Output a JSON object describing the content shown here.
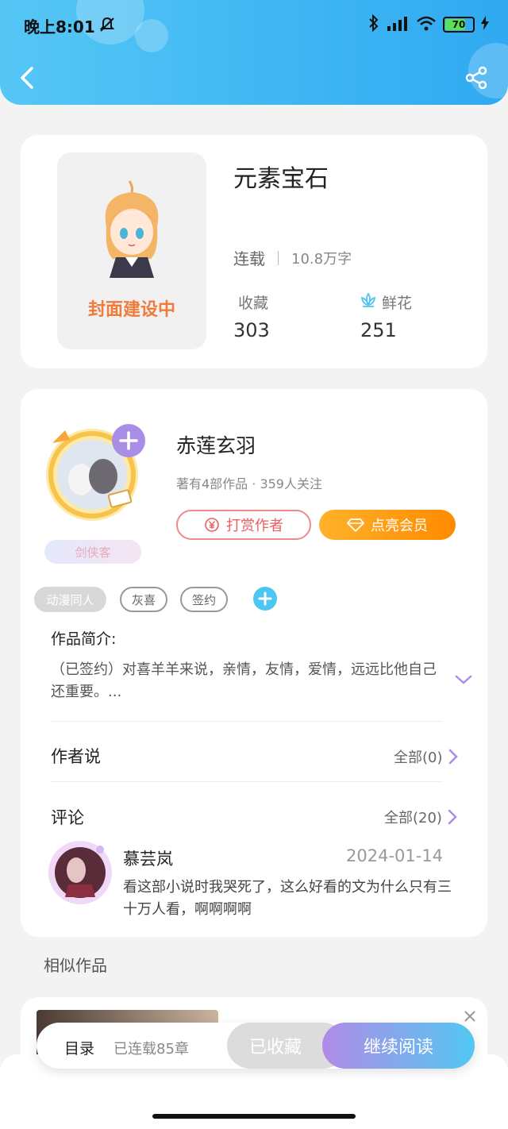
{
  "status_bar": {
    "time": "晚上8:01",
    "battery": "70",
    "battery_level": 0.7
  },
  "header": {
    "back_icon": "chevron-left-icon",
    "share_icon": "share-icon"
  },
  "book": {
    "title": "元素宝石",
    "cover_text": "封面建设中",
    "status": "连载",
    "word_count": "10.8万字",
    "favorites_label": "收藏",
    "favorites_value": "303",
    "flowers_label": "鲜花",
    "flowers_value": "251"
  },
  "author": {
    "name": "赤莲玄羽",
    "stats": "著有4部作品 · 359人关注",
    "badge": "剑侠客",
    "reward_button": "打赏作者",
    "vip_button": "点亮会员"
  },
  "tags": [
    "动漫同人",
    "灰喜",
    "签约"
  ],
  "intro": {
    "title": "作品简介:",
    "text": "（已签约）对喜羊羊来说，亲情，友情，爱情，远远比他自己还重要。..."
  },
  "author_says": {
    "title": "作者说",
    "link": "全部(0)"
  },
  "comments": {
    "title": "评论",
    "link": "全部(20)",
    "items": [
      {
        "user": "慕芸岚",
        "date": "2024-01-14",
        "text": "看这部小说时我哭死了，这么好看的文为什么只有三十万人看，啊啊啊啊"
      }
    ]
  },
  "similar": {
    "title": "相似作品"
  },
  "bottom_bar": {
    "toc_label": "目录",
    "chapters": "已连载85章",
    "collected_button": "已收藏",
    "continue_button": "继续阅读"
  },
  "colors": {
    "header": "#2fa9f1",
    "accent_orange": "#ff8a00",
    "accent_purple": "#a98ee6",
    "accent_blue": "#4fc6f2"
  }
}
